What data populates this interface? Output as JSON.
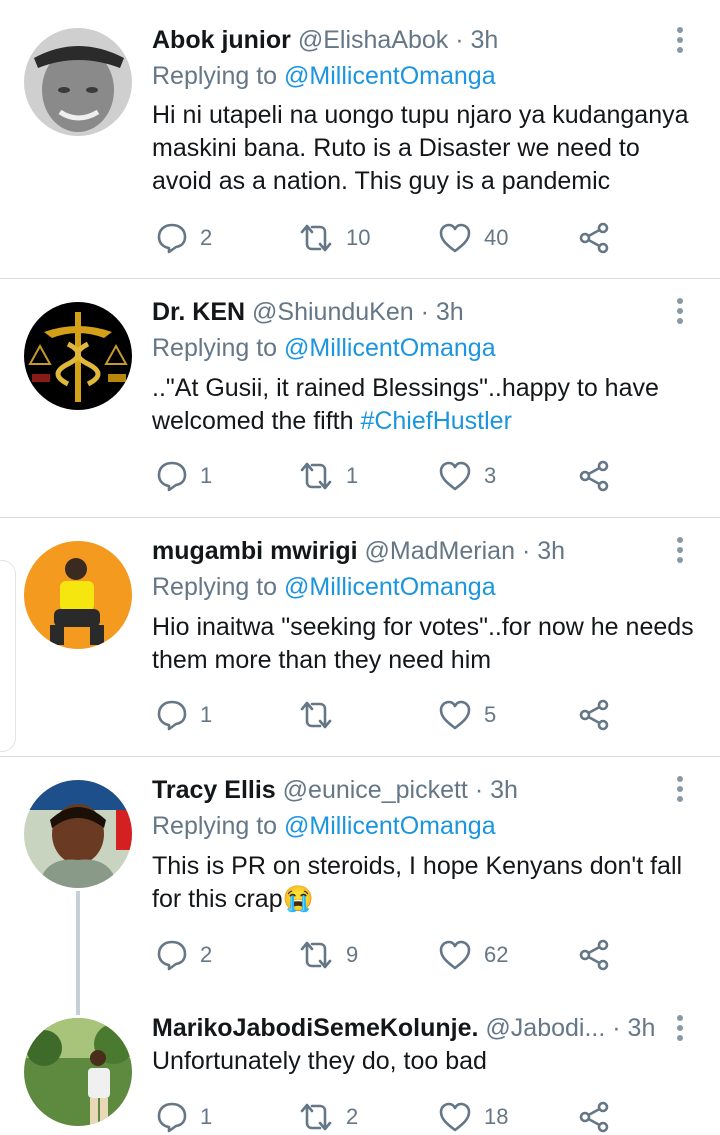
{
  "tweets": [
    {
      "name": "Abok junior",
      "handle": "@ElishaAbok",
      "separator": "·",
      "time": "3h",
      "replying_label": "Replying to",
      "replying_to": "@MillicentOmanga",
      "text": "Hi ni utapeli na uongo tupu njaro ya kudanganya maskini bana. Ruto is a Disaster we need to avoid as a nation. This guy is a pandemic",
      "hashtag": "",
      "replies": "2",
      "retweets": "10",
      "likes": "40"
    },
    {
      "name": "Dr. KEN",
      "handle": "@ShiunduKen",
      "separator": "·",
      "time": "3h",
      "replying_label": "Replying to",
      "replying_to": "@MillicentOmanga",
      "text": "..\"At Gusii, it rained Blessings\"..happy to have welcomed the fifth ",
      "hashtag": "#ChiefHustler",
      "replies": "1",
      "retweets": "1",
      "likes": "3"
    },
    {
      "name": "mugambi mwirigi",
      "handle": "@MadMerian",
      "separator": "·",
      "time": "3h",
      "replying_label": "Replying to",
      "replying_to": "@MillicentOmanga",
      "text": "Hio inaitwa \"seeking for votes\"..for now he needs them more than they need him",
      "hashtag": "",
      "replies": "1",
      "retweets": "",
      "likes": "5"
    },
    {
      "name": "Tracy Ellis",
      "handle": "@eunice_pickett",
      "separator": "·",
      "time": "3h",
      "replying_label": "Replying to",
      "replying_to": "@MillicentOmanga",
      "text": "This is PR on steroids, I hope Kenyans don't fall for this crap",
      "emoji": "😭",
      "hashtag": "",
      "replies": "2",
      "retweets": "9",
      "likes": "62"
    },
    {
      "name": "MarikoJabodiSemeKolunje.",
      "handle": "@Jabodi...",
      "separator": "·",
      "time": "3h",
      "text": "Unfortunately they do, too bad",
      "hashtag": "",
      "replies": "1",
      "retweets": "2",
      "likes": "18"
    }
  ],
  "icons": {
    "reply": "reply-icon",
    "retweet": "retweet-icon",
    "like": "like-icon",
    "share": "share-icon",
    "menu": "more-options-icon"
  },
  "colors": {
    "link": "#1b95e0",
    "secondary_text": "#657786",
    "divider": "#d9dde1"
  }
}
